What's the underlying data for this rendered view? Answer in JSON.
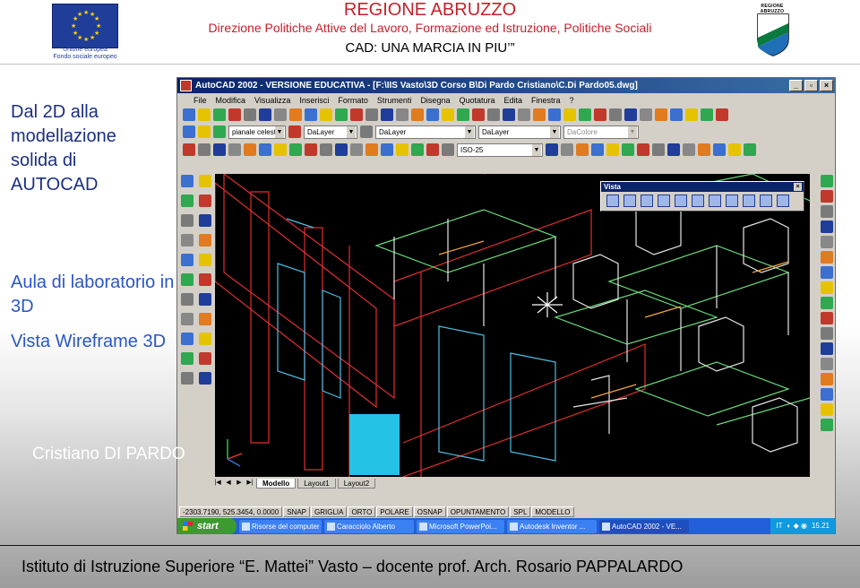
{
  "header": {
    "region": "REGIONE ABRUZZO",
    "subtitle": "Direzione Politiche Attive del Lavoro, Formazione ed Istruzione, Politiche Sociali",
    "course": "CAD: UNA MARCIA IN PIU’”",
    "eu_caption_1": "Unione europea",
    "eu_caption_2": "Fondo sociale europeo",
    "abruzzo_logo_text": "REGIONE ABRUZZO"
  },
  "left": {
    "heading": "Dal 2D alla modellazione solida di AUTOCAD",
    "lab": "Aula di laboratorio in 3D",
    "view": "Vista Wireframe 3D",
    "author": "Cristiano DI PARDO"
  },
  "footer": {
    "text": "Istituto di Istruzione Superiore “E. Mattei” Vasto – docente prof. Arch. Rosario PAPPALARDO"
  },
  "autocad": {
    "title": "AutoCAD 2002 - VERSIONE EDUCATIVA - [F:\\IIS Vasto\\3D Corso B\\Di Pardo Cristiano\\C.Di Pardo05.dwg]",
    "menu": [
      "File",
      "Modifica",
      "Visualizza",
      "Inserisci",
      "Formato",
      "Strumenti",
      "Disegna",
      "Quotatura",
      "Edita",
      "Finestra",
      "?"
    ],
    "layer_combo": "pianale celeste",
    "color_combo": "DaLayer",
    "linetype_combo": "DaLayer",
    "lineweight_combo": "DaLayer",
    "plotstyle_combo": "DaColore",
    "dimstyle_combo": "ISO-25",
    "vista_title": "Vista",
    "tabs": [
      "Modello",
      "Layout1",
      "Layout2"
    ],
    "coords": "-2303.7190, 525.3454, 0.0000",
    "status": [
      "SNAP",
      "GRIGLIA",
      "ORTO",
      "POLARE",
      "OSNAP",
      "OPUNTAMENTO",
      "SPL",
      "MODELLO"
    ]
  },
  "taskbar": {
    "start": "start",
    "tasks": [
      "Risorse del computer",
      "Caracciolo Alberto",
      "Microsoft PowerPoi...",
      "Autodesk Inventor ...",
      "AutoCAD 2002 - VE..."
    ],
    "lang": "IT",
    "clock": "15.21"
  }
}
